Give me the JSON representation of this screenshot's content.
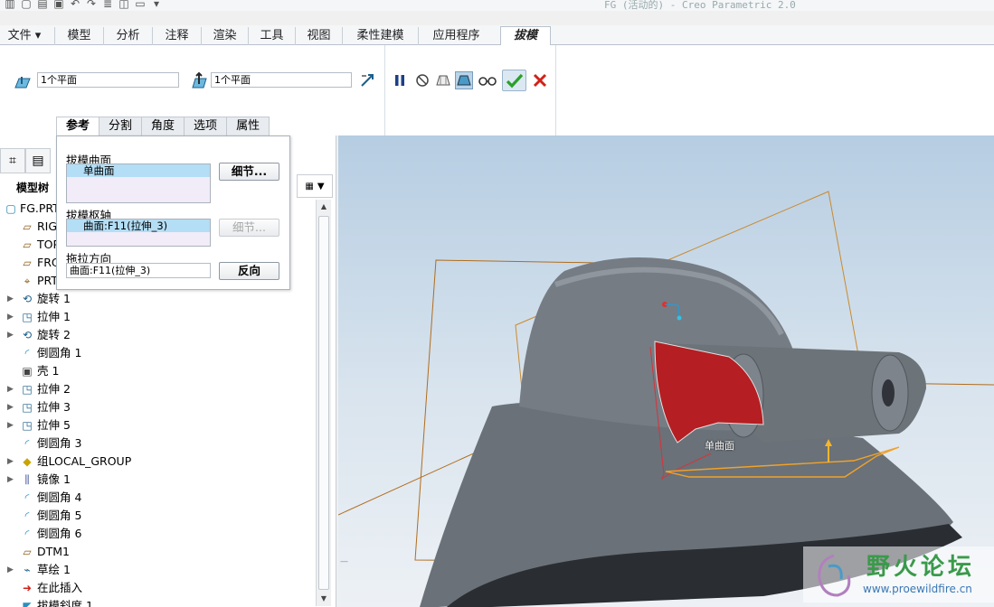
{
  "window_title": "FG (活动的) - Creo Parametric 2.0",
  "ribbon_tabs": [
    "文件",
    "模型",
    "分析",
    "注释",
    "渲染",
    "工具",
    "视图",
    "柔性建模",
    "应用程序",
    "拔模"
  ],
  "draft_fields": {
    "surface": "1个平面",
    "pivot": "1个平面"
  },
  "sub_tabs": [
    "参考",
    "分割",
    "角度",
    "选项",
    "属性"
  ],
  "references": {
    "draft_surfaces_label": "拔模曲面",
    "draft_surfaces_value": "单曲面",
    "details_button": "细节...",
    "draft_hinges_label": "拔模枢轴",
    "draft_hinges_value": "曲面:F11(拉伸_3)",
    "details_button_2": "细节...",
    "pull_direction_label": "拖拉方向",
    "pull_direction_value": "曲面:F11(拉伸_3)",
    "flip_button": "反向"
  },
  "model_tree": {
    "title": "模型树",
    "items": [
      {
        "label": "FG.PRT",
        "icon": "part-icon",
        "expand": false
      },
      {
        "label": "RIGHT",
        "icon": "datum-plane-icon",
        "expand": false
      },
      {
        "label": "TOP",
        "icon": "datum-plane-icon",
        "expand": false
      },
      {
        "label": "FRONT",
        "icon": "datum-plane-icon",
        "expand": false
      },
      {
        "label": "PRT_CSYS_DEF",
        "icon": "csys-icon",
        "expand": false
      },
      {
        "label": "旋转 1",
        "icon": "revolve-icon",
        "expand": true
      },
      {
        "label": "拉伸 1",
        "icon": "extrude-icon",
        "expand": true
      },
      {
        "label": "旋转 2",
        "icon": "revolve-icon",
        "expand": true
      },
      {
        "label": "倒圆角 1",
        "icon": "round-icon",
        "expand": false
      },
      {
        "label": "壳 1",
        "icon": "shell-icon",
        "expand": false
      },
      {
        "label": "拉伸 2",
        "icon": "extrude-icon",
        "expand": true
      },
      {
        "label": "拉伸 3",
        "icon": "extrude-icon",
        "expand": true
      },
      {
        "label": "拉伸 5",
        "icon": "extrude-icon",
        "expand": true
      },
      {
        "label": "倒圆角 3",
        "icon": "round-icon",
        "expand": false
      },
      {
        "label": "组LOCAL_GROUP",
        "icon": "group-icon",
        "expand": true
      },
      {
        "label": "镜像 1",
        "icon": "mirror-icon",
        "expand": true
      },
      {
        "label": "倒圆角 4",
        "icon": "round-icon",
        "expand": false
      },
      {
        "label": "倒圆角 5",
        "icon": "round-icon",
        "expand": false
      },
      {
        "label": "倒圆角 6",
        "icon": "round-icon",
        "expand": false
      },
      {
        "label": "DTM1",
        "icon": "datum-plane-icon",
        "expand": false
      },
      {
        "label": "草绘 1",
        "icon": "sketch-icon",
        "expand": true
      },
      {
        "label": "在此插入",
        "icon": "insert-arrow-icon",
        "expand": false
      },
      {
        "label": "拔模斜度 1",
        "icon": "draft-icon",
        "expand": false
      }
    ]
  },
  "viewport": {
    "surface_label": "单曲面"
  },
  "watermark": {
    "name": "野火论坛",
    "url": "www.proewildfire.cn"
  },
  "colors": {
    "accent_red": "#b51e22",
    "datum_orange": "#d48a1e",
    "ok_green": "#2aa02a",
    "cancel_red": "#d0221a"
  }
}
